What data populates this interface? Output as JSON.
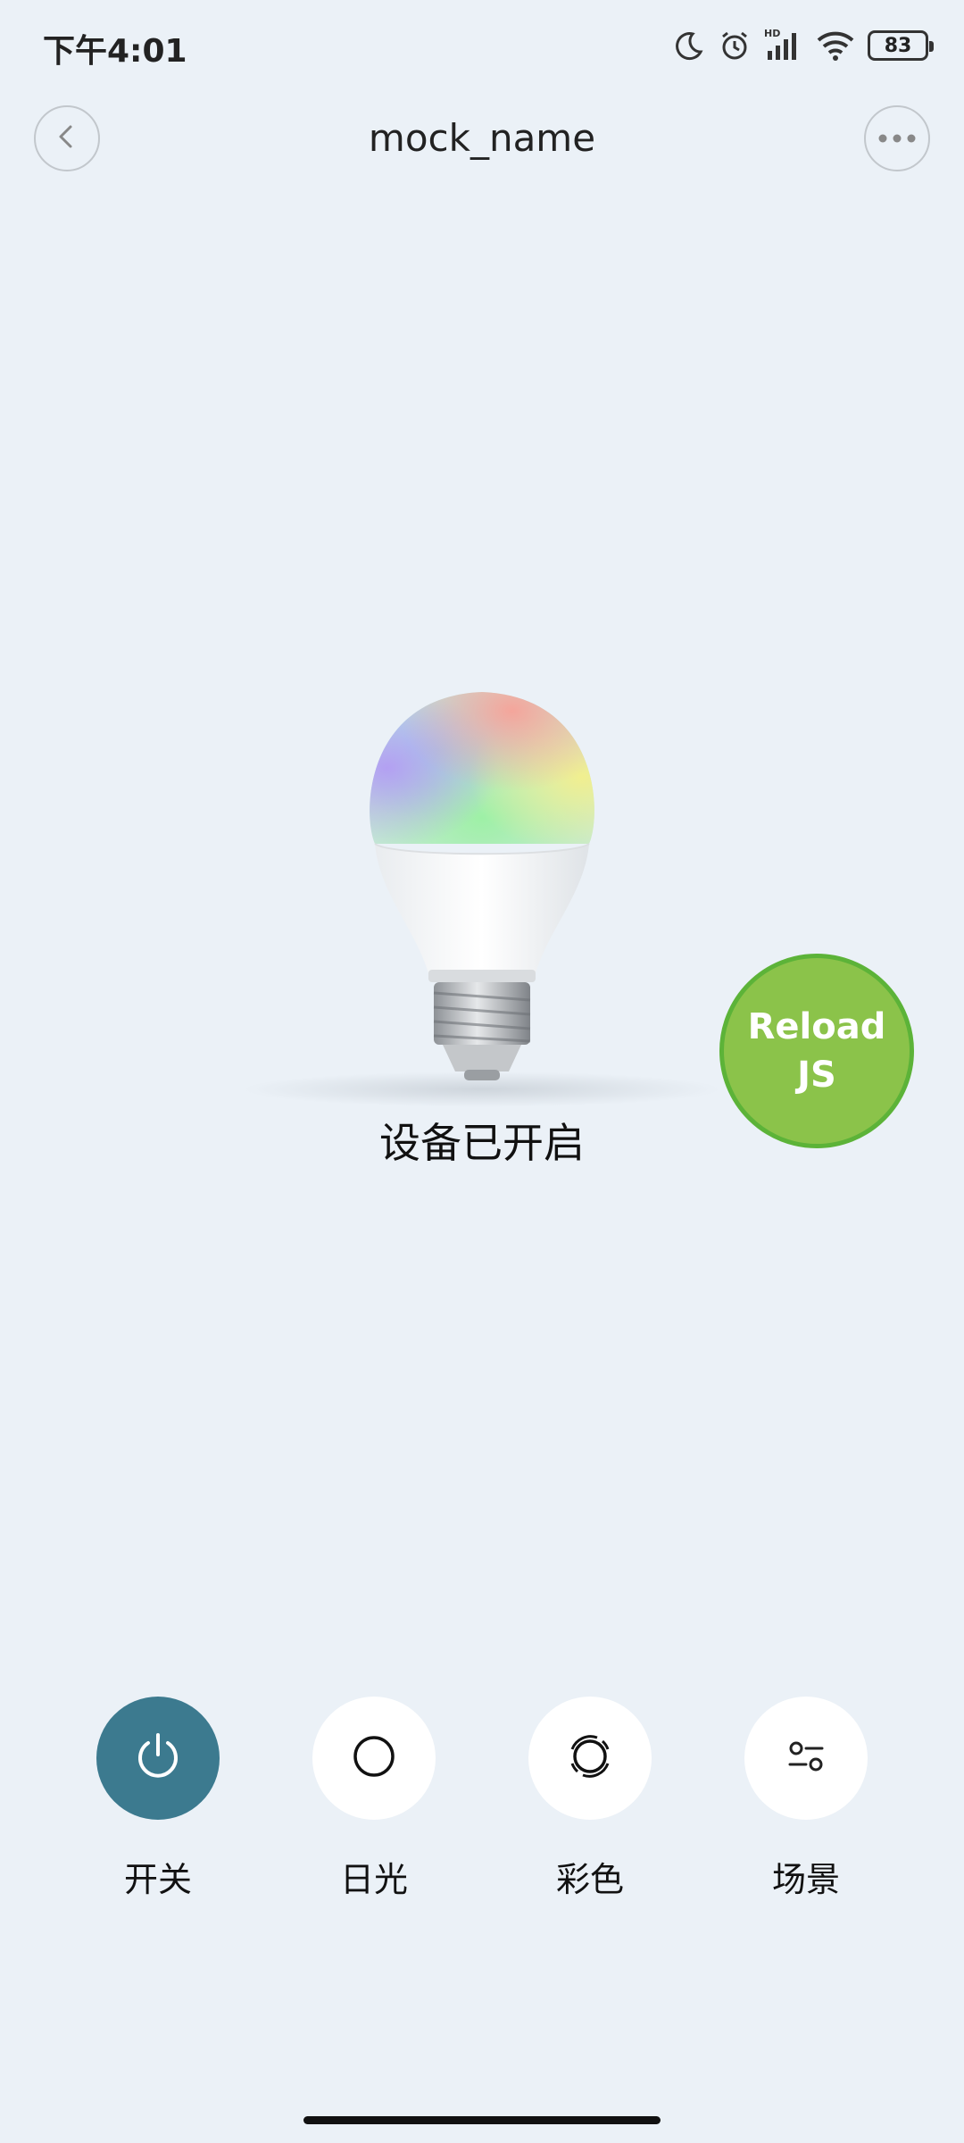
{
  "status_bar": {
    "time": "下午4:01",
    "battery": "83",
    "icons": [
      "moon-icon",
      "alarm-icon",
      "hd-signal-icon",
      "wifi-icon",
      "battery-icon"
    ]
  },
  "nav": {
    "title": "mock_name",
    "back_icon": "chevron-left-icon",
    "more_icon": "more-dots-icon"
  },
  "device": {
    "status": "设备已开启"
  },
  "reload_button": {
    "label": "Reload\nJS",
    "color": "#8bc34a"
  },
  "controls": [
    {
      "label": "开关",
      "icon": "power-icon",
      "active": true
    },
    {
      "label": "日光",
      "icon": "circle-icon",
      "active": false
    },
    {
      "label": "彩色",
      "icon": "color-ring-icon",
      "active": false
    },
    {
      "label": "场景",
      "icon": "scene-sliders-icon",
      "active": false
    }
  ],
  "colors": {
    "background": "#ebf1f7",
    "active_control": "#3c7a8f"
  }
}
